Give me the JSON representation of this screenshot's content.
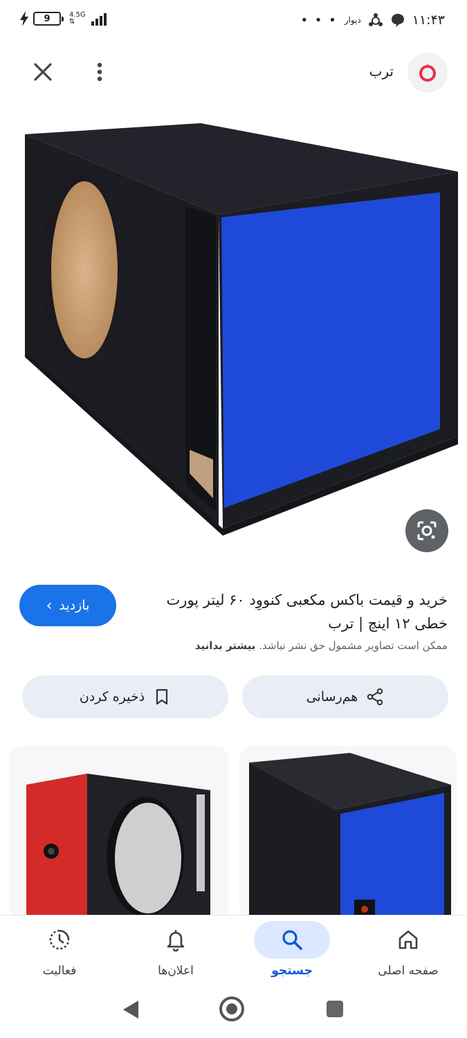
{
  "status_bar": {
    "battery": "9",
    "network_top": "4.5G",
    "network_bottom": "⇅",
    "time": "۱۱:۴۳",
    "overflow": "• • •",
    "app_label": "دیوار"
  },
  "header": {
    "site_name": "ترب",
    "close_icon": "close-icon",
    "more_icon": "more-vert-icon",
    "logo_color": "#e8324a"
  },
  "result": {
    "title": "خرید و قیمت باکس مکعبی کنووِد ۶۰ لیتر پورت خطی ۱۲ اینچ | ترب",
    "copyright_prefix": "ممکن است تصاویر مشمول حق نشر نباشد.",
    "copyright_link": "بیشتر بدانید",
    "visit_label": "بازدید"
  },
  "actions": {
    "share_label": "هم‌رسانی",
    "save_label": "ذخیره کردن"
  },
  "bottom_nav": {
    "home": "صفحه اصلی",
    "search": "جستجو",
    "notifications": "اعلان‌ها",
    "activity": "فعالیت"
  },
  "colors": {
    "accent": "#1a73e8",
    "pill_bg": "#e9eef6",
    "active_nav_bg": "#dce8ff",
    "box_blue": "#1f49d8",
    "box_red": "#d42a2a",
    "carpet_black": "#1c1d22"
  }
}
